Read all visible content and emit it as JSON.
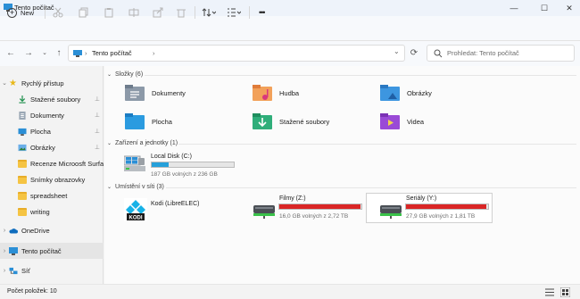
{
  "window": {
    "title": "Tento počítač",
    "minimize": "—",
    "maximize": "☐",
    "close": "✕"
  },
  "toolbar": {
    "new_label": "New",
    "more": "•••"
  },
  "address": {
    "path": "Tento počítač",
    "search_placeholder": "Prohledat: Tento počítač"
  },
  "sidebar": {
    "items": [
      {
        "label": "Rychlý přístup",
        "icon": "star-icon",
        "color": "#e8b81a"
      },
      {
        "label": "Stažené soubory",
        "icon": "download-icon",
        "pinned": "📌"
      },
      {
        "label": "Dokumenty",
        "icon": "document-icon",
        "pinned": "📌"
      },
      {
        "label": "Plocha",
        "icon": "desktop-icon",
        "pinned": "📌"
      },
      {
        "label": "Obrázky",
        "icon": "pictures-icon",
        "pinned": "📌"
      },
      {
        "label": "Recenze Microosft Surface Laptop",
        "icon": "folder-icon"
      },
      {
        "label": "Snímky obrazovky",
        "icon": "folder-icon"
      },
      {
        "label": "spreadsheet",
        "icon": "folder-icon"
      },
      {
        "label": "writing",
        "icon": "folder-icon"
      },
      {
        "label": "OneDrive",
        "icon": "cloud-icon"
      },
      {
        "label": "Tento počítač",
        "icon": "computer-icon"
      },
      {
        "label": "Síť",
        "icon": "network-icon"
      }
    ]
  },
  "sections": {
    "folders": {
      "title": "Složky (6)",
      "items": [
        "Dokumenty",
        "Hudba",
        "Obrázky",
        "Plocha",
        "Stažené soubory",
        "Videa"
      ]
    },
    "drives": {
      "title": "Zařízení a jednotky (1)",
      "items": [
        {
          "name": "Local Disk (C:)",
          "free": "187 GB volných z 236 GB",
          "used_fraction": 0.21,
          "color": "#26a0da"
        }
      ]
    },
    "network": {
      "title": "Umístění v síti (3)",
      "items": [
        {
          "name": "Kodi (LibreELEC)"
        },
        {
          "name": "Filmy (Z:)",
          "free": "16,0 GB volných z 2,72 TB",
          "used_fraction": 0.99,
          "color": "#da2626"
        },
        {
          "name": "Seriály (Y:)",
          "free": "27,9 GB volných z 1,81 TB",
          "used_fraction": 0.98,
          "color": "#da2626"
        }
      ]
    }
  },
  "status": {
    "count": "Počet položek: 10"
  },
  "colors": {
    "accent": "#0067c0",
    "selected": "#e5e5e5"
  }
}
